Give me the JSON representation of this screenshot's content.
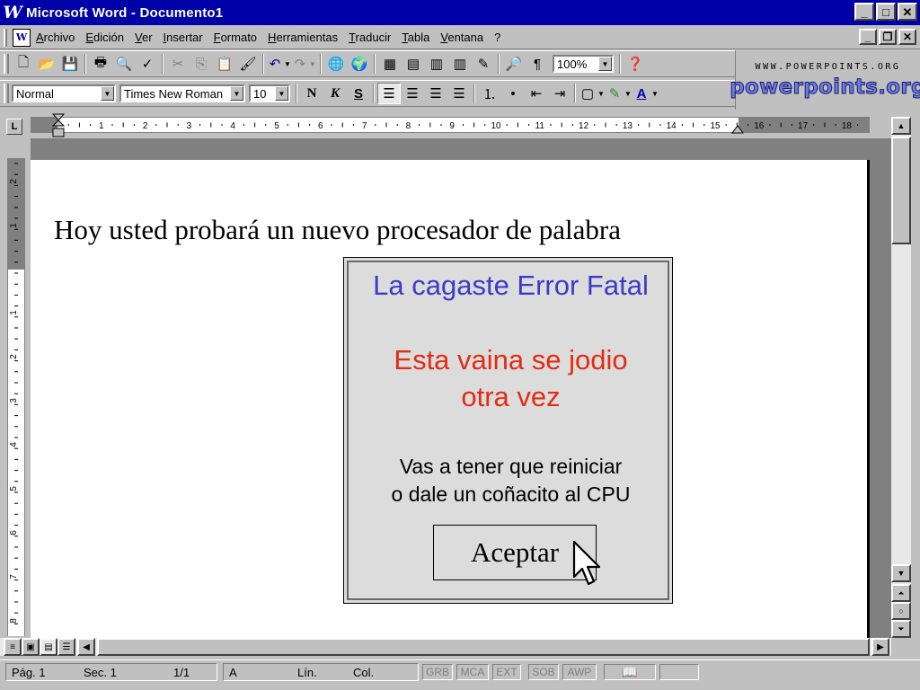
{
  "window": {
    "app_icon": "W",
    "title": "Microsoft Word - Documento1",
    "minimize": "_",
    "maximize": "□",
    "close": "✕"
  },
  "menu": {
    "items": [
      "Archivo",
      "Edición",
      "Ver",
      "Insertar",
      "Formato",
      "Herramientas",
      "Traducir",
      "Tabla",
      "Ventana",
      "?"
    ],
    "doc_minimize": "_",
    "doc_restore": "❐",
    "doc_close": "✕"
  },
  "toolbar_standard": {
    "zoom": "100%"
  },
  "toolbar_format": {
    "style": "Normal",
    "font": "Times New Roman",
    "size": "10",
    "bold": "N",
    "italic": "K",
    "underline": "S"
  },
  "logo": {
    "small_text": "WWW.POWERPOINTS.ORG",
    "big_text": "powerpoints.org"
  },
  "ruler": {
    "corner": "L",
    "labels": [
      "1",
      "2",
      "3",
      "4",
      "5",
      "6",
      "7",
      "8",
      "9",
      "10",
      "11",
      "12",
      "13",
      "14",
      "15",
      "16",
      "17",
      "18"
    ],
    "v_labels": [
      "2",
      "1",
      "1",
      "2",
      "3",
      "4",
      "5",
      "6",
      "7",
      "8"
    ]
  },
  "document": {
    "text": "Hoy usted probará un nuevo procesador de palabra"
  },
  "dialog": {
    "title": "La cagaste Error Fatal",
    "message_line1": "Esta vaina se jodio",
    "message_line2": "otra vez",
    "sub_line1": "Vas a tener que reiniciar",
    "sub_line2": "o dale un coñacito al CPU",
    "button": "Aceptar"
  },
  "statusbar": {
    "page": "Pág.  1",
    "section": "Sec.  1",
    "pages": "1/1",
    "at": "A",
    "line": "Lín.",
    "col": "Col.",
    "indicators": [
      "GRB",
      "MCA",
      "EXT",
      "SOB",
      "AWP"
    ]
  },
  "colors": {
    "titlebar": "#0000a8",
    "dialog_title": "#3b3bc6",
    "dialog_error": "#e22d14"
  }
}
